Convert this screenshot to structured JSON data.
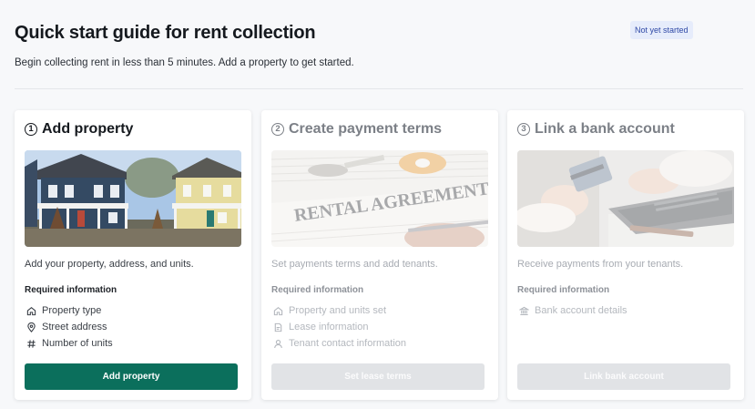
{
  "header": {
    "title": "Quick start guide for rent collection",
    "subtitle": "Begin collecting rent in less than 5 minutes. Add a property to get started.",
    "status": "Not yet started"
  },
  "colors": {
    "primary_button": "#0b6f5c",
    "badge_bg": "#e6ecfb",
    "badge_text": "#2f49a6",
    "disabled_button": "#e1e3e6"
  },
  "steps": [
    {
      "number": "1",
      "title": "Add property",
      "image": "houses-photo",
      "description": "Add your property, address, and units.",
      "required_heading": "Required information",
      "required": [
        {
          "icon": "home-icon",
          "label": "Property type"
        },
        {
          "icon": "map-pin-icon",
          "label": "Street address"
        },
        {
          "icon": "hash-icon",
          "label": "Number of units"
        }
      ],
      "button": "Add property",
      "active": true
    },
    {
      "number": "2",
      "title": "Create payment terms",
      "image": "rental-agreement-photo",
      "description": "Set payments terms and add tenants.",
      "required_heading": "Required information",
      "required": [
        {
          "icon": "home-icon",
          "label": "Property and units set"
        },
        {
          "icon": "document-icon",
          "label": "Lease information"
        },
        {
          "icon": "user-icon",
          "label": "Tenant contact information"
        }
      ],
      "button": "Set lease terms",
      "active": false
    },
    {
      "number": "3",
      "title": "Link a bank account",
      "image": "bank-card-laptop-photo",
      "description": "Receive payments from your tenants.",
      "required_heading": "Required information",
      "required": [
        {
          "icon": "bank-icon",
          "label": "Bank account details"
        }
      ],
      "button": "Link bank account",
      "active": false
    }
  ]
}
